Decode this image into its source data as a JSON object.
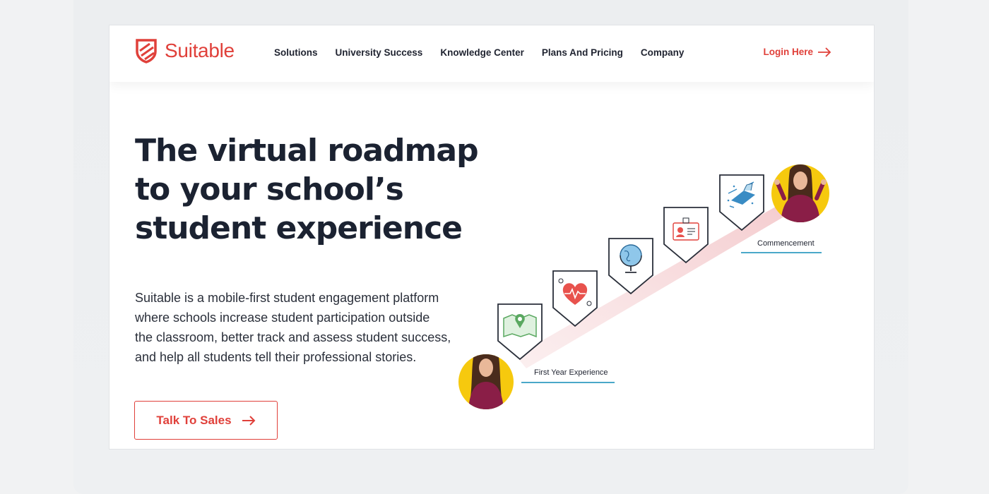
{
  "brand": {
    "name": "Suitable",
    "accent_color": "#e0403a",
    "text_color": "#1b2231"
  },
  "nav": {
    "items": [
      {
        "label": "Solutions"
      },
      {
        "label": "University Success"
      },
      {
        "label": "Knowledge Center"
      },
      {
        "label": "Plans And Pricing"
      },
      {
        "label": "Company"
      }
    ],
    "login_label": "Login Here"
  },
  "hero": {
    "headline_lines": [
      "The virtual roadmap",
      "to your school’s",
      "student experience"
    ],
    "description_lines": [
      "Suitable is a mobile-first student engagement platform",
      "where schools increase student participation outside",
      "the classroom, better track and assess student success,",
      "and help all students tell their professional stories."
    ],
    "cta_label": "Talk To Sales"
  },
  "roadmap": {
    "start_label": "First Year Experience",
    "end_label": "Commencement",
    "milestones": [
      {
        "icon": "map-icon"
      },
      {
        "icon": "heart-icon"
      },
      {
        "icon": "globe-icon"
      },
      {
        "icon": "id-card-icon"
      },
      {
        "icon": "graduation-cap-icon"
      }
    ]
  }
}
